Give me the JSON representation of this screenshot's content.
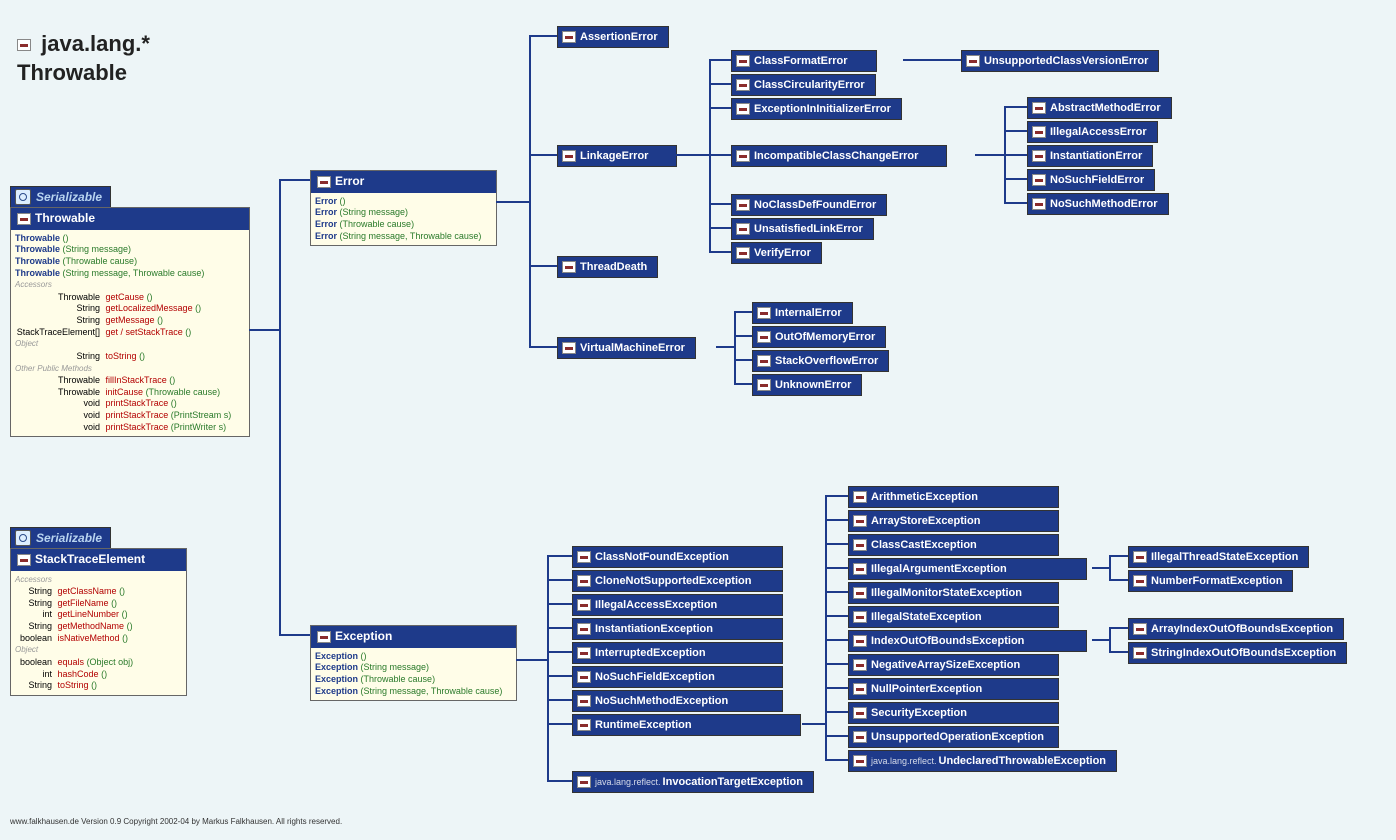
{
  "title": {
    "package": "java.lang.*",
    "class": "Throwable"
  },
  "interface_label": "Serializable",
  "footer": "www.falkhausen.de Version 0.9 Copyright 2002-04 by Markus Falkhausen. All rights reserved.",
  "throwable": {
    "name": "Throwable",
    "ctors": [
      {
        "name": "Throwable",
        "params": "()"
      },
      {
        "name": "Throwable",
        "params": "(String message)"
      },
      {
        "name": "Throwable",
        "params": "(Throwable cause)"
      },
      {
        "name": "Throwable",
        "params": "(String message, Throwable cause)"
      }
    ],
    "accessors_label": "Accessors",
    "accessors": [
      {
        "ret": "Throwable",
        "name": "getCause",
        "params": "()"
      },
      {
        "ret": "String",
        "name": "getLocalizedMessage",
        "params": "()"
      },
      {
        "ret": "String",
        "name": "getMessage",
        "params": "()"
      },
      {
        "ret": "StackTraceElement[]",
        "name": "get / setStackTrace",
        "params": "()"
      }
    ],
    "object_label": "Object",
    "object_methods": [
      {
        "ret": "String",
        "name": "toString",
        "params": "()"
      }
    ],
    "other_label": "Other Public Methods",
    "others": [
      {
        "ret": "Throwable",
        "name": "fillInStackTrace",
        "params": "()"
      },
      {
        "ret": "Throwable",
        "name": "initCause",
        "params": "(Throwable cause)"
      },
      {
        "ret": "void",
        "name": "printStackTrace",
        "params": "()"
      },
      {
        "ret": "void",
        "name": "printStackTrace",
        "params": "(PrintStream s)"
      },
      {
        "ret": "void",
        "name": "printStackTrace",
        "params": "(PrintWriter s)"
      }
    ]
  },
  "stacktrace": {
    "name": "StackTraceElement",
    "accessors_label": "Accessors",
    "accessors": [
      {
        "ret": "String",
        "name": "getClassName",
        "params": "()"
      },
      {
        "ret": "String",
        "name": "getFileName",
        "params": "()"
      },
      {
        "ret": "int",
        "name": "getLineNumber",
        "params": "()"
      },
      {
        "ret": "String",
        "name": "getMethodName",
        "params": "()"
      },
      {
        "ret": "boolean",
        "name": "isNativeMethod",
        "params": "()"
      }
    ],
    "object_label": "Object",
    "object_methods": [
      {
        "ret": "boolean",
        "name": "equals",
        "params": "(Object obj)"
      },
      {
        "ret": "int",
        "name": "hashCode",
        "params": "()"
      },
      {
        "ret": "String",
        "name": "toString",
        "params": "()"
      }
    ]
  },
  "error": {
    "name": "Error",
    "ctors": [
      {
        "name": "Error",
        "params": "()"
      },
      {
        "name": "Error",
        "params": "(String message)"
      },
      {
        "name": "Error",
        "params": "(Throwable cause)"
      },
      {
        "name": "Error",
        "params": "(String message, Throwable cause)"
      }
    ]
  },
  "exception": {
    "name": "Exception",
    "ctors": [
      {
        "name": "Exception",
        "params": "()"
      },
      {
        "name": "Exception",
        "params": "(String message)"
      },
      {
        "name": "Exception",
        "params": "(Throwable cause)"
      },
      {
        "name": "Exception",
        "params": "(String message, Throwable cause)"
      }
    ]
  },
  "errors": {
    "assertion": "AssertionError",
    "linkage": "LinkageError",
    "threaddeath": "ThreadDeath",
    "vme": "VirtualMachineError",
    "classformat": "ClassFormatError",
    "classcirc": "ClassCircularityError",
    "exceptionininit": "ExceptionInInitializerError",
    "incompat": "IncompatibleClassChangeError",
    "noclassdef": "NoClassDefFoundError",
    "unsatisfiedlink": "UnsatisfiedLinkError",
    "verify": "VerifyError",
    "unsupportedcv": "UnsupportedClassVersionError",
    "abstractmethod": "AbstractMethodError",
    "illegalaccess": "IllegalAccessError",
    "instantiation": "InstantiationError",
    "nosuchfield": "NoSuchFieldError",
    "nosuchmethod": "NoSuchMethodError",
    "internal": "InternalError",
    "outofmemory": "OutOfMemoryError",
    "stackoverflow": "StackOverflowError",
    "unknown": "UnknownError"
  },
  "exceptions": {
    "classnotfound": "ClassNotFoundException",
    "clonenotsupported": "CloneNotSupportedException",
    "illegalaccess": "IllegalAccessException",
    "instantiation": "InstantiationException",
    "interrupted": "InterruptedException",
    "nosuchfield": "NoSuchFieldException",
    "nosuchmethod": "NoSuchMethodException",
    "runtime": "RuntimeException",
    "invocationtarget": "InvocationTargetException",
    "invocationtarget_prefix": "java.lang.reflect.",
    "arithmetic": "ArithmeticException",
    "arraystore": "ArrayStoreException",
    "classcast": "ClassCastException",
    "illegalargument": "IllegalArgumentException",
    "illegalmonitorstate": "IllegalMonitorStateException",
    "illegalstate": "IllegalStateException",
    "indexoob": "IndexOutOfBoundsException",
    "negativearraysize": "NegativeArraySizeException",
    "nullpointer": "NullPointerException",
    "security": "SecurityException",
    "unsupportedop": "UnsupportedOperationException",
    "undeclaredthrowable": "UndeclaredThrowableException",
    "undeclaredthrowable_prefix": "java.lang.reflect.",
    "illegalthreadstate": "IllegalThreadStateException",
    "numberformat": "NumberFormatException",
    "arrayioob": "ArrayIndexOutOfBoundsException",
    "stringioob": "StringIndexOutOfBoundsException"
  }
}
